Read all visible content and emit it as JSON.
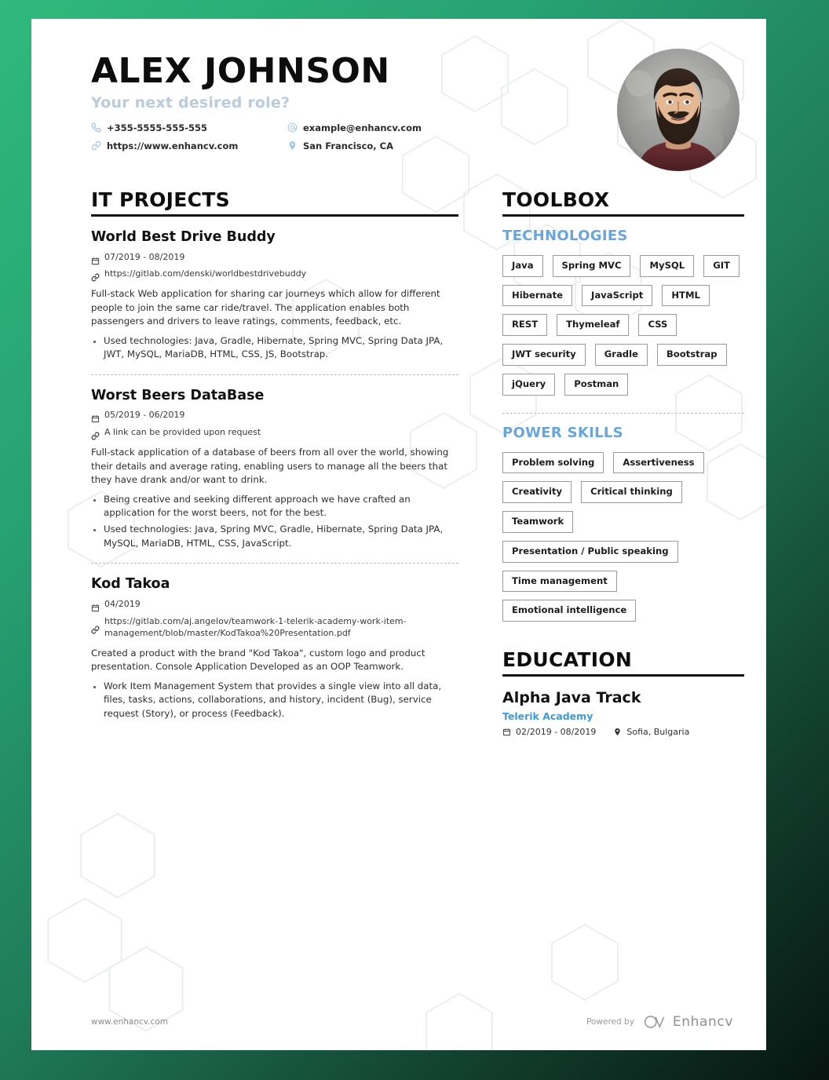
{
  "theme": {
    "accent_blue": "#6aa5da",
    "link_blue": "#3e9ad6",
    "subtitle_blue": "#bacbdb",
    "bg_green_start": "#2fb97c",
    "bg_green_end": "#071410"
  },
  "header": {
    "name": "ALEX JOHNSON",
    "subtitle": "Your next desired role?",
    "contacts": [
      {
        "icon": "phone-icon",
        "text": "+355-5555-555-555"
      },
      {
        "icon": "email-icon",
        "text": "example@enhancv.com"
      },
      {
        "icon": "link-icon",
        "text": "https://www.enhancv.com"
      },
      {
        "icon": "location-pin-icon",
        "text": "San Francisco, CA"
      }
    ]
  },
  "projects": {
    "title": "IT PROJECTS",
    "items": [
      {
        "title": "World Best Drive Buddy",
        "date": "07/2019 - 08/2019",
        "link": "https://gitlab.com/denski/worldbestdrivebuddy",
        "description": "Full-stack Web application for sharing car journeys which allow for different people to join the same car ride/travel. The application enables both passengers and drivers to leave ratings, comments, feedback, etc.",
        "bullets": [
          "Used technologies: Java, Gradle, Hibernate, Spring MVC, Spring Data JPA, JWT, MySQL, MariaDB, HTML, CSS, JS, Bootstrap."
        ]
      },
      {
        "title": "Worst Beers DataBase",
        "date": "05/2019 - 06/2019",
        "link": "A link can be provided upon request",
        "description": "Full-stack application of a database of beers from all over the world, showing their details and average rating, enabling users to manage all the beers that they have drank and/or want to drink.",
        "bullets": [
          "Being creative and seeking different approach we have crafted an application for the worst beers, not for the best.",
          "Used technologies: Java, Spring MVC, Gradle, Hibernate, Spring Data JPA, MySQL, MariaDB, HTML, CSS, JavaScript."
        ]
      },
      {
        "title": "Kod Takoa",
        "date": "04/2019",
        "link": "https://gitlab.com/aj.angelov/teamwork-1-telerik-academy-work-item-management/blob/master/KodTakoa%20Presentation.pdf",
        "description": "Created a product with the brand \"Kod Takoa\", custom logo and product presentation. Console Application Developed as an OOP Teamwork.",
        "bullets": [
          "Work Item Management System that provides a single view into all data, files, tasks, actions, collaborations, and history, incident (Bug), service request (Story), or process (Feedback)."
        ]
      }
    ]
  },
  "toolbox": {
    "title": "TOOLBOX",
    "technologies_label": "TECHNOLOGIES",
    "technologies": [
      "Java",
      "Spring MVC",
      "MySQL",
      "GIT",
      "Hibernate",
      "JavaScript",
      "HTML",
      "REST",
      "Thymeleaf",
      "CSS",
      "JWT security",
      "Gradle",
      "Bootstrap",
      "jQuery",
      "Postman"
    ],
    "power_skills_label": "POWER SKILLS",
    "power_skills": [
      "Problem solving",
      "Assertiveness",
      "Creativity",
      "Critical thinking",
      "Teamwork",
      "Presentation / Public speaking",
      "Time management",
      "Emotional intelligence"
    ]
  },
  "education": {
    "title": "EDUCATION",
    "degree": "Alpha Java Track",
    "organization": "Telerik Academy",
    "date": "02/2019 - 08/2019",
    "location": "Sofia, Bulgaria"
  },
  "footer": {
    "site": "www.enhancv.com",
    "powered_by": "Powered by",
    "brand": "Enhancv"
  }
}
